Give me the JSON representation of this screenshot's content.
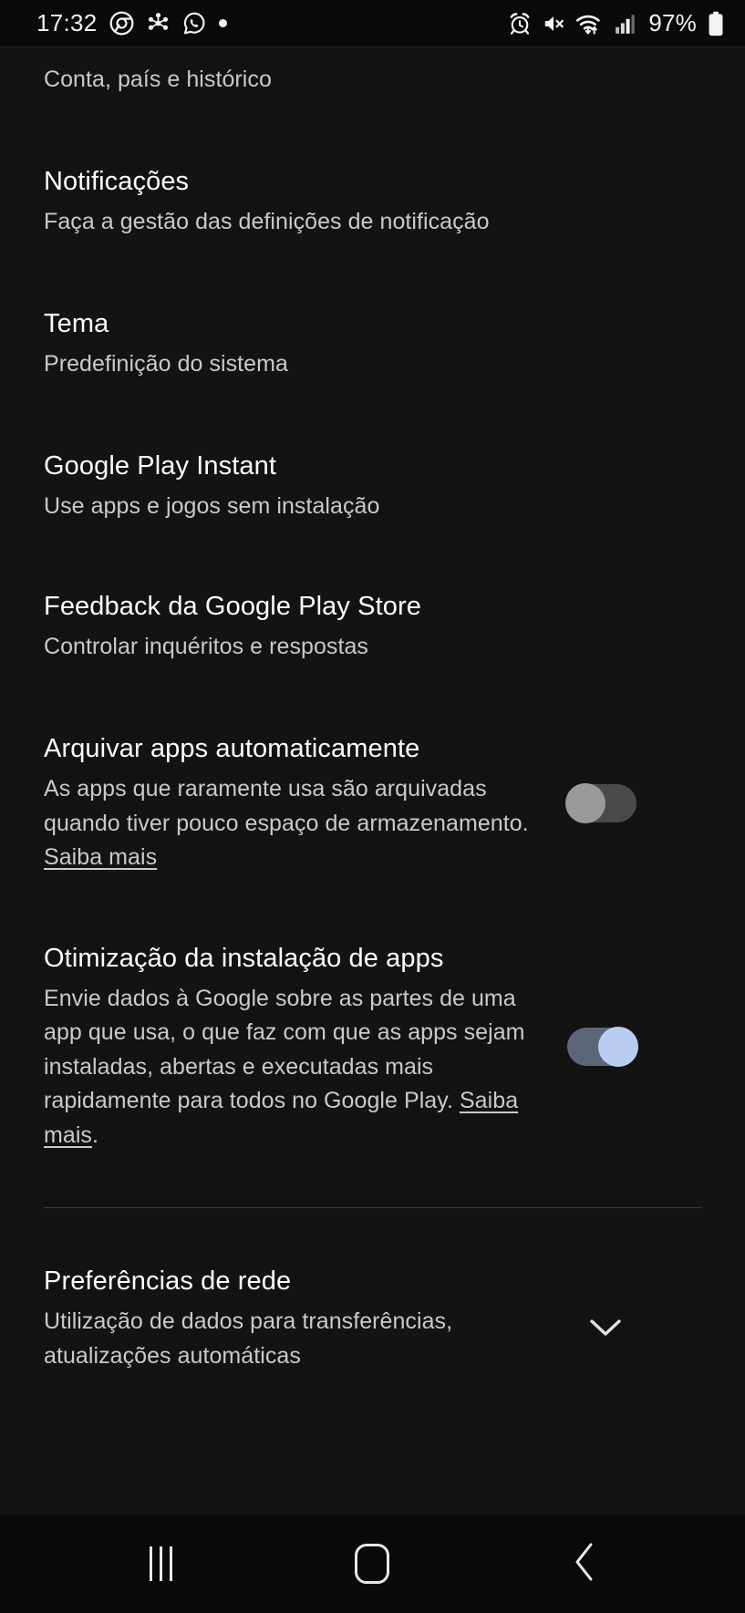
{
  "status_bar": {
    "time": "17:32",
    "left_icons": [
      "chrome-icon",
      "cluster-icon",
      "whatsapp-icon",
      "dot-icon"
    ],
    "right_icons": [
      "alarm-icon",
      "mute-icon",
      "wifi-icon",
      "signal-icon"
    ],
    "battery_percent": "97%",
    "battery_icon": "battery-full-icon"
  },
  "settings": {
    "rows": [
      {
        "title": "",
        "subtitle": "Conta, país e histórico",
        "control": "none"
      },
      {
        "title": "Notificações",
        "subtitle": "Faça a gestão das definições de notificação",
        "control": "none"
      },
      {
        "title": "Tema",
        "subtitle": "Predefinição do sistema",
        "control": "none"
      },
      {
        "title": "Google Play Instant",
        "subtitle": "Use apps e jogos sem instalação",
        "control": "none"
      },
      {
        "title": "Feedback da Google Play Store",
        "subtitle": "Controlar inquéritos e respostas",
        "control": "none"
      },
      {
        "title": "Arquivar apps automaticamente",
        "subtitle": "As apps que raramente usa são arquivadas quando tiver pouco espaço de armazenamento. ",
        "link_text": "Saiba mais",
        "subtitle_tail": "",
        "control": "toggle",
        "toggle_state": "off"
      },
      {
        "title": "Otimização da instalação de apps",
        "subtitle": "Envie dados à Google sobre as partes de uma app que usa, o que faz com que as apps sejam instaladas, abertas e executadas mais rapidamente para todos no Google Play. ",
        "link_text": "Saiba mais",
        "subtitle_tail": ".",
        "control": "toggle",
        "toggle_state": "on"
      },
      {
        "title": "Preferências de rede",
        "subtitle": "Utilização de dados para transferências, atualizações automáticas",
        "control": "chevron"
      }
    ]
  },
  "nav_bar": {
    "recents_label": "recents-button",
    "home_label": "home-button",
    "back_label": "back-button"
  },
  "colors": {
    "background": "#131313",
    "status_bar_bg": "#0a0a0a",
    "title_text": "#fdfdfd",
    "subtitle_text": "#ccc9c6",
    "toggle_on_knob": "#b9cdf2",
    "toggle_on_track": "#5c6678",
    "toggle_off_knob": "#9a9a9a",
    "toggle_off_track": "#4a4a4a",
    "divider": "#3c3c3c"
  }
}
